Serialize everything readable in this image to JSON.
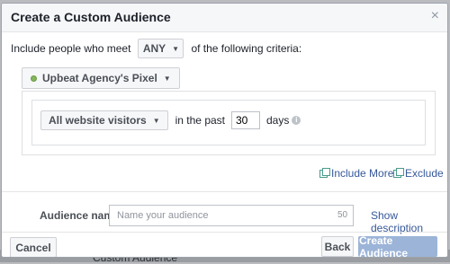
{
  "backdrop": {
    "text": "Custom Audience"
  },
  "modal": {
    "title": "Create a Custom Audience",
    "close_symbol": "×",
    "include_prefix": "Include people who meet",
    "match_value": "ANY",
    "include_suffix": "of the following criteria:",
    "pixel": {
      "name": "Upbeat Agency's Pixel",
      "status_color": "#84b65a"
    },
    "criteria": {
      "visitor_option": "All website visitors",
      "in_the_past": "in the past",
      "days_value": "30",
      "days_label": "days",
      "info_symbol": "i"
    },
    "links": {
      "include_more": "Include More",
      "exclude": "Exclude"
    },
    "audience_name": {
      "label": "Audience name",
      "placeholder": "Name your audience",
      "char_limit": "50",
      "show_description": "Show description"
    },
    "footer": {
      "cancel": "Cancel",
      "back": "Back",
      "create": "Create Audience"
    }
  },
  "icons": {
    "close": "close-icon",
    "caret": "caret-down-icon",
    "status": "pixel-status-dot-icon",
    "info": "info-icon",
    "copy": "copy-icon"
  },
  "colors": {
    "link": "#365899",
    "primary_disabled": "#9cb4d8",
    "header_bg": "#f6f7f9"
  }
}
